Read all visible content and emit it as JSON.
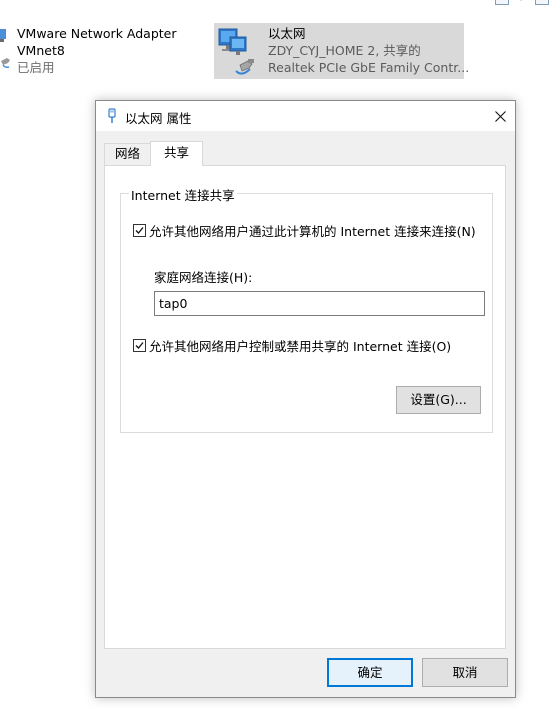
{
  "background": {
    "adapters": [
      {
        "name": "VMware Network Adapter",
        "line2": "VMnet8",
        "status": "已启用"
      },
      {
        "name": "以太网",
        "line2": "ZDY_CYJ_HOME 2, 共享的",
        "status": "Realtek PCIe GbE Family Contr..."
      }
    ]
  },
  "dialog": {
    "title": "以太网 属性",
    "tabs": [
      {
        "label": "网络",
        "active": false
      },
      {
        "label": "共享",
        "active": true
      }
    ],
    "sharing": {
      "group_title": "Internet 连接共享",
      "allow_connect": {
        "label": "允许其他网络用户通过此计算机的 Internet 连接来连接(N)",
        "checked": true
      },
      "home_network_label": "家庭网络连接(H):",
      "home_network_value": "tap0",
      "allow_control": {
        "label": "允许其他网络用户控制或禁用共享的 Internet 连接(O)",
        "checked": true
      },
      "settings_button": "设置(G)..."
    },
    "ok_button": "确定",
    "cancel_button": "取消"
  },
  "icons": {
    "title": "ethernet-plug-icon",
    "close": "close-icon",
    "adapter": "network-adapter-icon"
  },
  "colors": {
    "selected_adapter_bg": "#d9d9d9",
    "default_button_border": "#0078d7",
    "dialog_bg": "#f0f0f0"
  }
}
